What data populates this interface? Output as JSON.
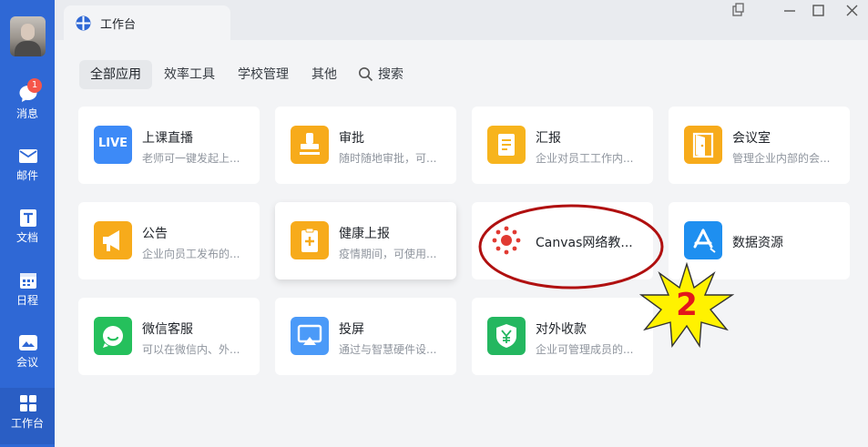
{
  "window": {
    "tab_title": "工作台"
  },
  "sidebar": {
    "items": [
      {
        "label": "消息",
        "icon": "chat-icon",
        "badge": "1"
      },
      {
        "label": "邮件",
        "icon": "mail-icon"
      },
      {
        "label": "文档",
        "icon": "doc-icon"
      },
      {
        "label": "日程",
        "icon": "calendar-icon"
      },
      {
        "label": "会议",
        "icon": "meeting-icon"
      },
      {
        "label": "工作台",
        "icon": "workbench-icon",
        "active": true
      }
    ]
  },
  "categories": [
    "全部应用",
    "效率工具",
    "学校管理",
    "其他",
    "搜索"
  ],
  "apps": [
    {
      "name": "上课直播",
      "desc": "老师可一键发起上...",
      "icon": "live-icon",
      "icon_text": "LIVE",
      "color": "#3d8af7"
    },
    {
      "name": "审批",
      "desc": "随时随地审批，可...",
      "icon": "approval-stamp-icon",
      "color": "#f7ab1b"
    },
    {
      "name": "汇报",
      "desc": "企业对员工工作内...",
      "icon": "report-icon",
      "color": "#f7b41d"
    },
    {
      "name": "会议室",
      "desc": "管理企业内部的会...",
      "icon": "meeting-room-door-icon",
      "color": "#f7ab1b"
    },
    {
      "name": "公告",
      "desc": "企业向员工发布的...",
      "icon": "megaphone-icon",
      "color": "#f7ab1b"
    },
    {
      "name": "健康上报",
      "desc": "疫情期间，可使用...",
      "icon": "health-report-icon",
      "color": "#f7ab1b"
    },
    {
      "name": "Canvas网络教...",
      "desc": "",
      "icon": "canvas-logo-icon",
      "color": "#e13a32"
    },
    {
      "name": "数据资源",
      "desc": "",
      "icon": "app-store-icon",
      "color": "#1e8ff0"
    },
    {
      "name": "微信客服",
      "desc": "可以在微信内、外...",
      "icon": "wechat-service-icon",
      "color": "#25c05c"
    },
    {
      "name": "投屏",
      "desc": "通过与智慧硬件设...",
      "icon": "screen-cast-icon",
      "color": "#4b9af8"
    },
    {
      "name": "对外收款",
      "desc": "企业可管理成员的...",
      "icon": "payment-shield-icon",
      "color": "#24b760"
    }
  ],
  "annotation": {
    "number": "2"
  }
}
